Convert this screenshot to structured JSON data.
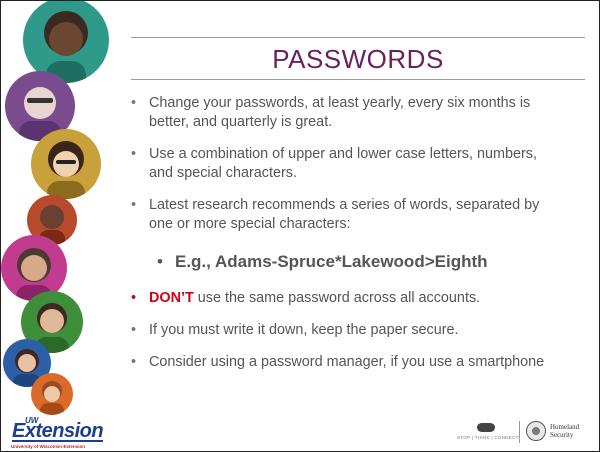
{
  "slide": {
    "title": "PASSWORDS",
    "bullets": [
      {
        "text": "Change your passwords, at least yearly, every six months is better, and quarterly is great."
      },
      {
        "text": "Use a combination of upper and lower case letters, numbers, and special characters."
      },
      {
        "text": "Latest research recommends a series of words, separated by one or more special characters:"
      }
    ],
    "example": "E.g., Adams-Spruce*Lakewood>Eighth",
    "dont": {
      "emphasis": "DON’T",
      "rest": " use the same password across all accounts."
    },
    "bullets_after": [
      {
        "text": "If you must write it down, keep the paper secure."
      },
      {
        "text": "Consider using a password manager, if you use a smartphone"
      }
    ],
    "bullet_glyph": "•"
  },
  "footer": {
    "uw_label": "UW",
    "extension_label": "Extension",
    "extension_sub": "University of Wisconsin-Extension",
    "campaign_words": "STOP | THINK | CONNECT",
    "dhs_line1": "Homeland",
    "dhs_line2": "Security"
  },
  "colors": {
    "title": "#6b1f5e",
    "text": "#555555",
    "accent_red": "#d0021b",
    "logo_blue": "#1b3f8f"
  },
  "icons": [
    "person-photo",
    "dhs-seal-icon",
    "stop-think-connect-icon"
  ]
}
